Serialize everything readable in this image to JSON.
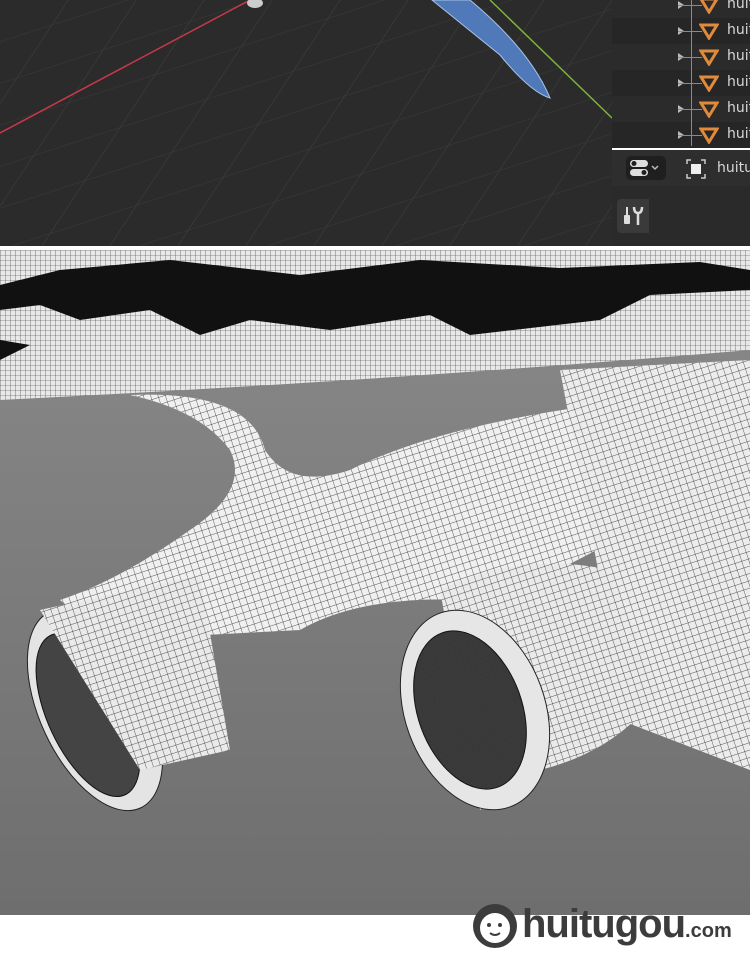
{
  "outliner": {
    "items": [
      {
        "label": "huit"
      },
      {
        "label": "huit"
      },
      {
        "label": "huit"
      },
      {
        "label": "huit"
      },
      {
        "label": "huit"
      },
      {
        "label": "huit"
      }
    ]
  },
  "properties": {
    "object_name": "huitu"
  },
  "watermark": {
    "brand": "huitugou",
    "suffix": ".com"
  },
  "colors": {
    "x_axis": "#c8394a",
    "y_axis": "#7fb33a",
    "mesh_icon": "#e08a3c"
  }
}
